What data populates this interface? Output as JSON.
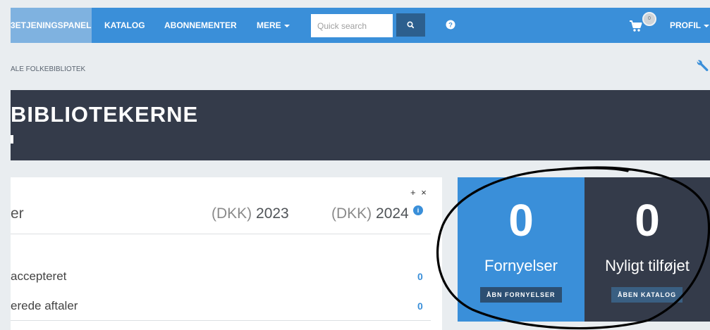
{
  "navbar": {
    "items": [
      {
        "label": "3ETJENINGSPANEL",
        "active": true
      },
      {
        "label": "KATALOG"
      },
      {
        "label": "ABONNEMENTER"
      },
      {
        "label": "MERE"
      }
    ],
    "search": {
      "placeholder": "Quick search",
      "value": ""
    },
    "search_icon": "search-icon",
    "help_icon": "question-circle-icon",
    "cart_icon": "shopping-cart-icon",
    "cart_count": "0",
    "profile_label": "PROFIL"
  },
  "breadcrumb": {
    "text": "ALE FOLKEBIBLIOTEK"
  },
  "settings_icon": "wrench-icon",
  "banner": {
    "title": "BIBLIOTEKERNE"
  },
  "table": {
    "tools": "+ ×",
    "headers": {
      "label": "er",
      "col2023": {
        "unit": "(DKK)",
        "year": "2023"
      },
      "col2024": {
        "unit": "(DKK)",
        "year": "2024"
      }
    },
    "rows": [
      {
        "label": "accepteret",
        "value": "0"
      },
      {
        "label": "erede aftaler",
        "value": "0"
      }
    ]
  },
  "tiles": [
    {
      "number": "0",
      "label": "Fornyelser",
      "button": "ÅBN FORNYELSER"
    },
    {
      "number": "0",
      "label": "Nyligt tilføjet",
      "button": "ÅBEN KATALOG"
    }
  ],
  "colors": {
    "accent": "#3a8fd9",
    "dark": "#343b4a",
    "background": "#e9edf0"
  }
}
